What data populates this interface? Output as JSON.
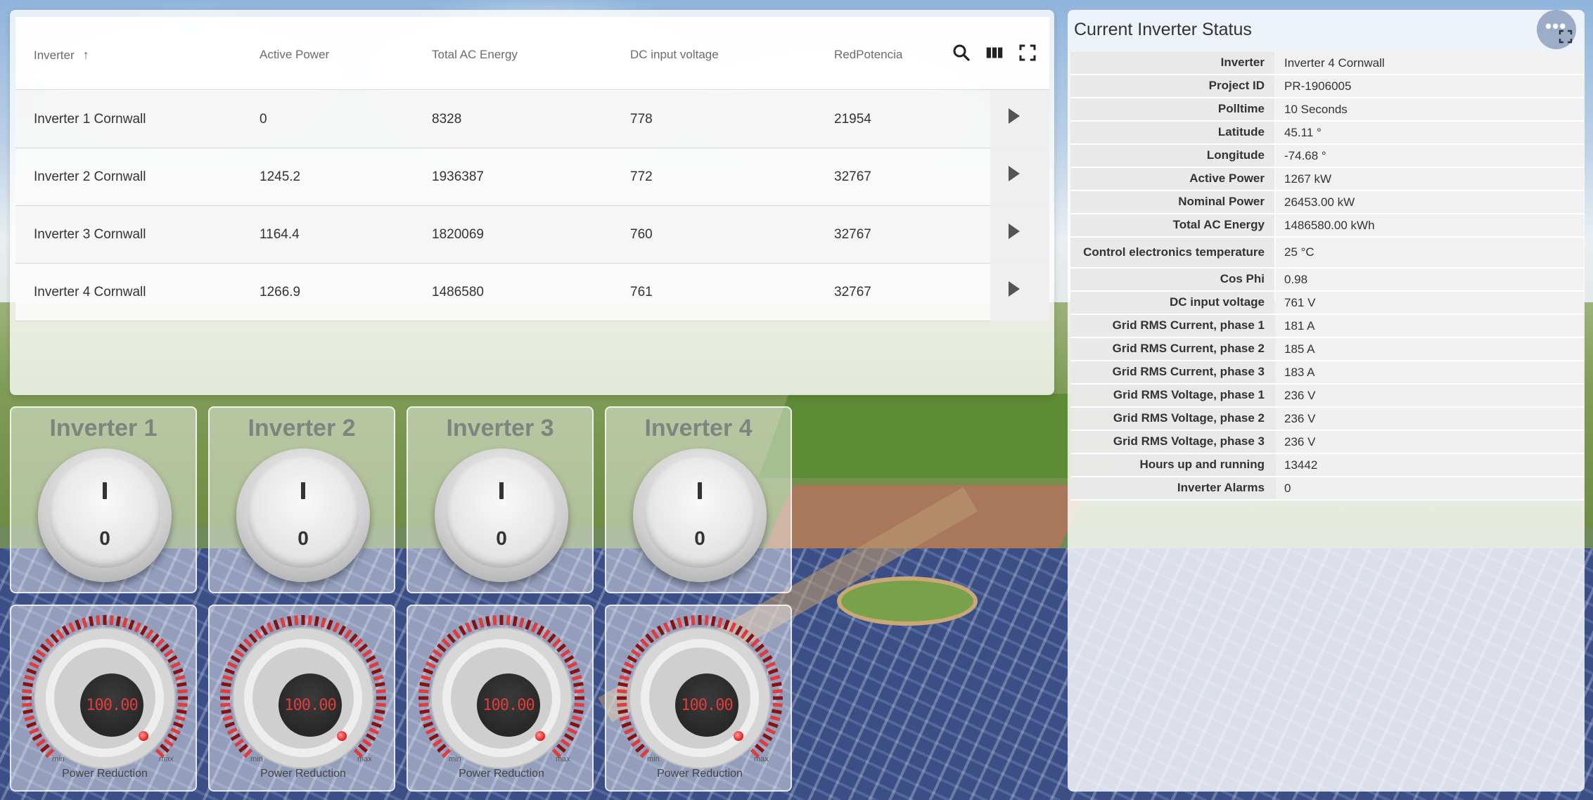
{
  "table": {
    "columns": [
      "Inverter",
      "Active Power",
      "Total AC Energy",
      "DC input voltage",
      "RedPotencia"
    ],
    "rows": [
      {
        "inverter": "Inverter 1 Cornwall",
        "active_power": "0",
        "total_ac_energy": "8328",
        "dc_input_voltage": "778",
        "red_potencia": "21954"
      },
      {
        "inverter": "Inverter 2 Cornwall",
        "active_power": "1245.2",
        "total_ac_energy": "1936387",
        "dc_input_voltage": "772",
        "red_potencia": "32767"
      },
      {
        "inverter": "Inverter 3 Cornwall",
        "active_power": "1164.4",
        "total_ac_energy": "1820069",
        "dc_input_voltage": "760",
        "red_potencia": "32767"
      },
      {
        "inverter": "Inverter 4 Cornwall",
        "active_power": "1266.9",
        "total_ac_energy": "1486580",
        "dc_input_voltage": "761",
        "red_potencia": "32767"
      }
    ],
    "sort_column": "Inverter",
    "sort_direction": "ascending",
    "toolbar_icons": [
      "search-icon",
      "columns-icon",
      "fullscreen-icon"
    ]
  },
  "switches": [
    {
      "title": "Inverter 1",
      "on_label": "I",
      "off_label": "0"
    },
    {
      "title": "Inverter 2",
      "on_label": "I",
      "off_label": "0"
    },
    {
      "title": "Inverter 3",
      "on_label": "I",
      "off_label": "0"
    },
    {
      "title": "Inverter 4",
      "on_label": "I",
      "off_label": "0"
    }
  ],
  "gauges": [
    {
      "value": "100.00",
      "label": "Power Reduction",
      "min_label": "min",
      "max_label": "max"
    },
    {
      "value": "100.00",
      "label": "Power Reduction",
      "min_label": "min",
      "max_label": "max"
    },
    {
      "value": "100.00",
      "label": "Power Reduction",
      "min_label": "min",
      "max_label": "max"
    },
    {
      "value": "100.00",
      "label": "Power Reduction",
      "min_label": "min",
      "max_label": "max"
    }
  ],
  "status": {
    "title": "Current Inverter Status",
    "menu_icon": "more-icon",
    "fullscreen_icon": "fullscreen-icon",
    "fields": [
      {
        "key": "Inverter",
        "value": "Inverter 4 Cornwall"
      },
      {
        "key": "Project ID",
        "value": "PR-1906005"
      },
      {
        "key": "Polltime",
        "value": "10 Seconds"
      },
      {
        "key": "Latitude",
        "value": "45.11 °"
      },
      {
        "key": "Longitude",
        "value": "-74.68 °"
      },
      {
        "key": "Active Power",
        "value": "1267 kW"
      },
      {
        "key": "Nominal Power",
        "value": "26453.00 kW"
      },
      {
        "key": "Total AC Energy",
        "value": "1486580.00 kWh"
      },
      {
        "key": "Control electronics temperature",
        "value": "25 °C"
      },
      {
        "key": "Cos Phi",
        "value": "0.98"
      },
      {
        "key": "DC input voltage",
        "value": "761 V"
      },
      {
        "key": "Grid RMS Current, phase 1",
        "value": "181 A"
      },
      {
        "key": "Grid RMS Current, phase 2",
        "value": "185 A"
      },
      {
        "key": "Grid RMS Current, phase 3",
        "value": "183 A"
      },
      {
        "key": "Grid RMS Voltage, phase 1",
        "value": "236 V"
      },
      {
        "key": "Grid RMS Voltage, phase 2",
        "value": "236 V"
      },
      {
        "key": "Grid RMS Voltage, phase 3",
        "value": "236 V"
      },
      {
        "key": "Hours up and running",
        "value": "13442"
      },
      {
        "key": "Inverter Alarms",
        "value": "0"
      }
    ]
  },
  "colors": {
    "gauge_accent": "#e23b3b",
    "panel_bg": "#ffffff",
    "row_bg": "#f5f5f5"
  }
}
